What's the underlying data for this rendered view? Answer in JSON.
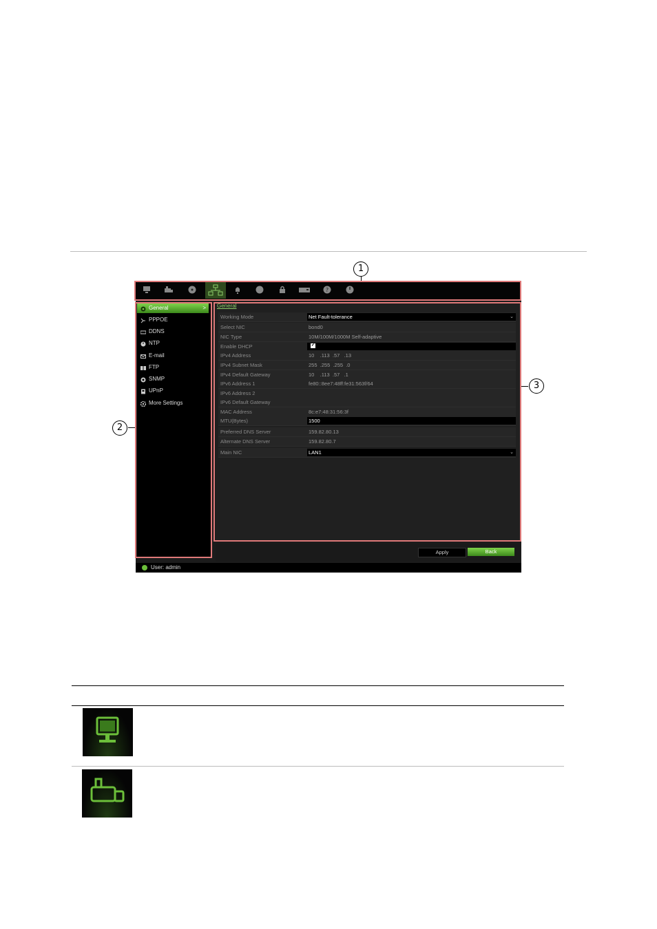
{
  "callouts": [
    "1",
    "2",
    "3"
  ],
  "colors": {
    "accent": "#6cbf3a",
    "highlight": "#e07a7a",
    "panel": "#1c1c1c"
  },
  "toolbar": {
    "icons": [
      "monitor-icon",
      "camera-icon",
      "disk-icon",
      "network-icon",
      "alarm-icon",
      "hdd-icon",
      "lock-icon",
      "device-icon",
      "help-icon",
      "power-icon"
    ],
    "active_index": 3
  },
  "sidebar": {
    "items": [
      {
        "label": "General",
        "icon": "gear-icon",
        "active": true
      },
      {
        "label": "PPPOE",
        "icon": "pppoe-icon"
      },
      {
        "label": "DDNS",
        "icon": "ddns-icon"
      },
      {
        "label": "NTP",
        "icon": "ntp-icon"
      },
      {
        "label": "E-mail",
        "icon": "mail-icon"
      },
      {
        "label": "FTP",
        "icon": "ftp-icon"
      },
      {
        "label": "SNMP",
        "icon": "snmp-icon"
      },
      {
        "label": "UPnP",
        "icon": "upnp-icon"
      },
      {
        "label": "More Settings",
        "icon": "settings-icon"
      }
    ],
    "active_arrow": ">"
  },
  "content": {
    "title": "General",
    "rows": [
      {
        "label": "Working Mode",
        "value": "Net Fault-tolerance"
      },
      {
        "label": "Select NIC",
        "value": "bond0"
      },
      {
        "label": "NIC Type",
        "value": "10M/100M/1000M Self-adaptive"
      },
      {
        "label": "Enable DHCP",
        "value": "✔"
      },
      {
        "label": "IPv4 Address",
        "value": "10    .113  .57   .13"
      },
      {
        "label": "IPv4 Subnet Mask",
        "value": "255  .255  .255  .0"
      },
      {
        "label": "IPv4 Default Gateway",
        "value": "10    .113  .57   .1"
      },
      {
        "label": "IPv6 Address 1",
        "value": "fe80::8ee7:48ff:fe31:563f/64"
      },
      {
        "label": "IPv6 Address 2",
        "value": ""
      },
      {
        "label": "IPv6 Default Gateway",
        "value": ""
      },
      {
        "label": "MAC Address",
        "value": "8c:e7:48:31:56:3f"
      },
      {
        "label": "MTU(Bytes)",
        "value": "1500"
      },
      {
        "label": "Preferred DNS Server",
        "value": "159.82.80.13"
      },
      {
        "label": "Alternate DNS Server",
        "value": "159.82.80.7"
      },
      {
        "label": "Main NIC",
        "value": "LAN1"
      }
    ],
    "dropdown_glyph": "⌄"
  },
  "buttons": {
    "apply": "Apply",
    "back": "Back"
  },
  "status": {
    "user": "User: admin"
  },
  "legend_icons": [
    "monitor-icon",
    "camera-icon"
  ]
}
